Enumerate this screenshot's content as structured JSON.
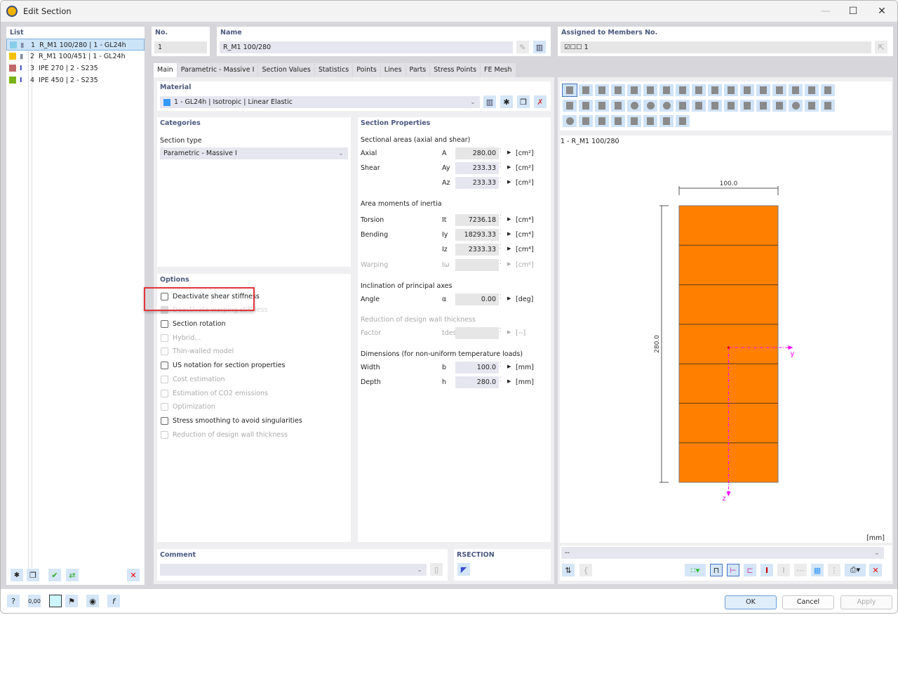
{
  "window": {
    "title": "Edit Section",
    "minimize": "—",
    "maximize": "☐",
    "close": "✕"
  },
  "list": {
    "title": "List",
    "items": [
      {
        "label": "1  R_M1 100/280 | 1 - GL24h",
        "color": "#87ceeb",
        "icon": "rect-section-icon",
        "selected": true
      },
      {
        "label": "2  R_M1 100/451 | 1 - GL24h",
        "color": "#f5c000",
        "icon": "rect-section-icon",
        "selected": false
      },
      {
        "label": "3  IPE 270 | 2 - S235",
        "color": "#c06a6a",
        "icon": "i-section-icon",
        "selected": false
      },
      {
        "label": "4  IPE 450 | 2 - S235",
        "color": "#7ab317",
        "icon": "i-section-icon",
        "selected": false
      }
    ]
  },
  "no": {
    "label": "No.",
    "value": "1"
  },
  "name": {
    "label": "Name",
    "value": "R_M1 100/280"
  },
  "assigned": {
    "label": "Assigned to Members No.",
    "value": "☑☐☐ 1"
  },
  "tabs": [
    "Main",
    "Parametric - Massive I",
    "Section Values",
    "Statistics",
    "Points",
    "Lines",
    "Parts",
    "Stress Points",
    "FE Mesh"
  ],
  "material": {
    "label": "Material",
    "value": "1 - GL24h | Isotropic | Linear Elastic",
    "color": "#3399ff"
  },
  "categories": {
    "title": "Categories",
    "section_type_label": "Section type",
    "section_type_value": "Parametric - Massive I"
  },
  "options": {
    "title": "Options",
    "items": [
      {
        "label": "Deactivate shear stiffness",
        "enabled": true,
        "checked": false
      },
      {
        "label": "Deactivate warping stiffness",
        "enabled": false,
        "checked": true
      },
      {
        "label": "Section rotation",
        "enabled": true,
        "checked": false
      },
      {
        "label": "Hybrid...",
        "enabled": false,
        "checked": false
      },
      {
        "label": "Thin-walled model",
        "enabled": false,
        "checked": false
      },
      {
        "label": "US notation for section properties",
        "enabled": true,
        "checked": false
      },
      {
        "label": "Cost estimation",
        "enabled": false,
        "checked": false
      },
      {
        "label": "Estimation of CO2 emissions",
        "enabled": false,
        "checked": false
      },
      {
        "label": "Optimization",
        "enabled": false,
        "checked": false
      },
      {
        "label": "Stress smoothing to avoid singularities",
        "enabled": true,
        "checked": false
      },
      {
        "label": "Reduction of design wall thickness",
        "enabled": false,
        "checked": false
      }
    ]
  },
  "props": {
    "title": "Section Properties",
    "areas_title": "Sectional areas (axial and shear)",
    "axial": {
      "label": "Axial",
      "sym": "A",
      "value": "280.00",
      "unit": "[cm²]"
    },
    "shear_y": {
      "label": "Shear",
      "sym": "Ay",
      "value": "233.33",
      "unit": "[cm²]"
    },
    "shear_z": {
      "label": "",
      "sym": "Az",
      "value": "233.33",
      "unit": "[cm²]"
    },
    "inertia_title": "Area moments of inertia",
    "torsion": {
      "label": "Torsion",
      "sym": "It",
      "value": "7236.18",
      "unit": "[cm⁴]"
    },
    "bending_y": {
      "label": "Bending",
      "sym": "Iy",
      "value": "18293.33",
      "unit": "[cm⁴]"
    },
    "bending_z": {
      "label": "",
      "sym": "Iz",
      "value": "2333.33",
      "unit": "[cm⁴]"
    },
    "warping": {
      "label": "Warping",
      "sym": "Iω",
      "value": "",
      "unit": "[cm⁶]"
    },
    "incl_title": "Inclination of principal axes",
    "angle": {
      "label": "Angle",
      "sym": "α",
      "value": "0.00",
      "unit": "[deg]"
    },
    "red_title": "Reduction of design wall thickness",
    "factor": {
      "label": "Factor",
      "sym": "tdes/t",
      "value": "",
      "unit": "[--]"
    },
    "dim_title": "Dimensions (for non-uniform temperature loads)",
    "width": {
      "label": "Width",
      "sym": "b",
      "value": "100.0",
      "unit": "[mm]"
    },
    "depth": {
      "label": "Depth",
      "sym": "h",
      "value": "280.0",
      "unit": "[mm]"
    }
  },
  "preview": {
    "caption": "1 - R_M1 100/280",
    "width_dim": "100.0",
    "height_dim": "280.0",
    "axis_y": "y",
    "axis_z": "z",
    "unit": "[mm]",
    "dropdown": "--",
    "fill_color": "#ff8000",
    "axis_color": "#ff00ff",
    "lamellae": 7
  },
  "comment": {
    "label": "Comment",
    "value": ""
  },
  "rsection": {
    "label": "RSECTION"
  },
  "buttons": {
    "ok": "OK",
    "cancel": "Cancel",
    "apply": "Apply"
  }
}
